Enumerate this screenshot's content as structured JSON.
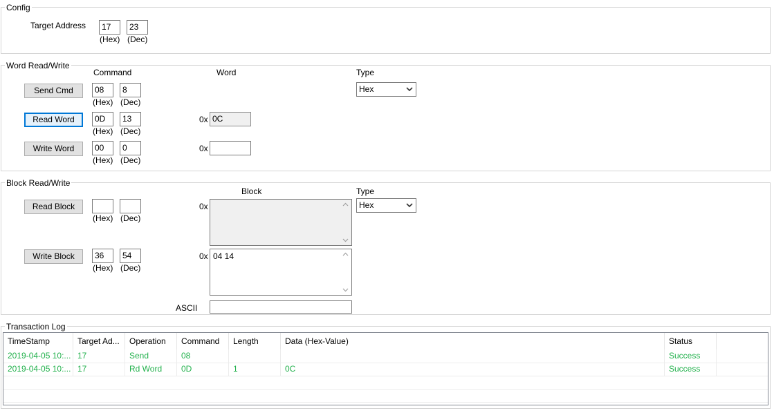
{
  "config": {
    "legend": "Config",
    "target_address_label": "Target Address",
    "hex_value": "17",
    "dec_value": "23",
    "hex_label": "(Hex)",
    "dec_label": "(Dec)"
  },
  "word_rw": {
    "legend": "Word Read/Write",
    "command_header": "Command",
    "word_header": "Word",
    "type_header": "Type",
    "type_value": "Hex",
    "hex_label": "(Hex)",
    "dec_label": "(Dec)",
    "prefix": "0x",
    "send_cmd": {
      "label": "Send Cmd",
      "hex": "08",
      "dec": "8"
    },
    "read_word": {
      "label": "Read Word",
      "hex": "0D",
      "dec": "13",
      "value": "0C"
    },
    "write_word": {
      "label": "Write Word",
      "hex": "00",
      "dec": "0",
      "value": ""
    }
  },
  "block_rw": {
    "legend": "Block Read/Write",
    "block_header": "Block",
    "type_header": "Type",
    "type_value": "Hex",
    "hex_label": "(Hex)",
    "dec_label": "(Dec)",
    "prefix": "0x",
    "read_block": {
      "label": "Read Block",
      "hex": "",
      "dec": "",
      "value": ""
    },
    "write_block": {
      "label": "Write Block",
      "hex": "36",
      "dec": "54",
      "value": "04 14"
    },
    "ascii_label": "ASCII",
    "ascii_value": ""
  },
  "log": {
    "legend": "Transaction Log",
    "columns": [
      "TimeStamp",
      "Target Ad...",
      "Operation",
      "Command",
      "Length",
      "Data (Hex-Value)",
      "Status"
    ],
    "rows": [
      [
        "2019-04-05 10:...",
        "17",
        "Send",
        "08",
        "",
        "",
        "Success"
      ],
      [
        "2019-04-05 10:...",
        "17",
        "Rd Word",
        "0D",
        "1",
        "0C",
        "Success"
      ]
    ]
  },
  "colors": {
    "success_text": "#22b14c",
    "focus_border": "#0078d7"
  },
  "icons": {
    "dropdown": "chevron-down-icon",
    "scroll_up": "chevron-up-icon",
    "scroll_down": "chevron-down-icon"
  }
}
